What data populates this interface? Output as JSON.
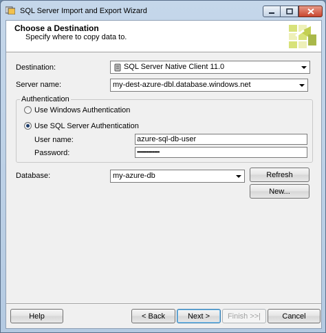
{
  "window": {
    "title": "SQL Server Import and Export Wizard"
  },
  "header": {
    "title": "Choose a Destination",
    "subtitle": "Specify where to copy data to."
  },
  "form": {
    "destination_label": "Destination:",
    "destination_value": "SQL Server Native Client 11.0",
    "server_label": "Server name:",
    "server_value": "my-dest-azure-dbl.database.windows.net",
    "auth_group_label": "Authentication",
    "windows_auth_label": "Use Windows Authentication",
    "sql_auth_label": "Use SQL Server Authentication",
    "username_label": "User name:",
    "username_value": "azure-sql-db-user",
    "password_label": "Password:",
    "password_value": "••••••••••••••••••",
    "database_label": "Database:",
    "database_value": "my-azure-db",
    "refresh_label": "Refresh",
    "new_label": "New..."
  },
  "footer": {
    "help_label": "Help",
    "back_label": "< Back",
    "next_label": "Next >",
    "finish_label": "Finish >>|",
    "cancel_label": "Cancel"
  },
  "colors": {
    "title_bar": "#b4cae2",
    "close_button": "#c8462f",
    "default_button_border": "#3c7fb1"
  }
}
